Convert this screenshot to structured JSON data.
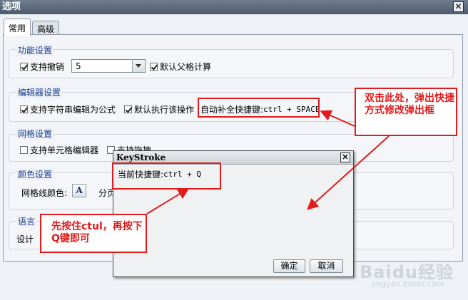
{
  "window": {
    "title": "选项",
    "close_glyph": "✕"
  },
  "tabs": [
    {
      "label": "常用"
    },
    {
      "label": "高级"
    }
  ],
  "groups": {
    "function": {
      "title": "功能设置",
      "support_undo_label": "支持撤销",
      "undo_levels_value": "5",
      "default_parent_calc_label": "默认父格计算"
    },
    "editor": {
      "title": "编辑器设置",
      "string_as_formula_label": "支持字符串编辑为公式",
      "default_run_label": "默认执行该操作",
      "autocomplete_label": "自动补全快捷键:",
      "autocomplete_shortcut": "ctrl + SPACE"
    },
    "grid": {
      "title": "网格设置",
      "cell_editor_label": "支持单元格编辑器",
      "drag_label": "支持拖拽"
    },
    "color": {
      "title": "颜色设置",
      "gridline_color_label": "网格线颜色:",
      "font_button_glyph": "A",
      "divider_label": "分页"
    },
    "language": {
      "title": "语言",
      "design_label": "设计"
    }
  },
  "dialog": {
    "title": "KeyStroke",
    "close_glyph": "✕",
    "current_label": "当前快捷键:",
    "current_shortcut": "ctrl + Q",
    "ok_label": "确定",
    "cancel_label": "取消"
  },
  "annotations": {
    "top_callout": "双击此处，弹出快捷方式修改弹出框",
    "bottom_callout": "先按住ctul，再按下Q键即可"
  },
  "watermark": {
    "text": "Baidu经验",
    "sub": "jingyan.baidu.com"
  },
  "colors": {
    "annotation_red": "#e21c1c",
    "group_title_blue": "#1a3d8f"
  }
}
